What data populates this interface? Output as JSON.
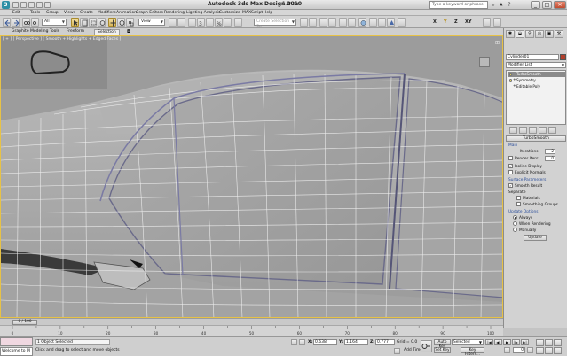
{
  "titlebar": {
    "app_title": "Autodesk 3ds Max Design 2010",
    "file_name": "1.max",
    "search_placeholder": "Type a keyword or phrase",
    "minimize": "_",
    "maximize": "□",
    "close": "✕"
  },
  "menu": [
    "Edit",
    "Tools",
    "Group",
    "Views",
    "Create",
    "Modifiers",
    "Animation",
    "Graph Editors",
    "Rendering",
    "Lighting Analysis",
    "Customize",
    "MAXScript",
    "Help"
  ],
  "toolbar": {
    "selection_filter": "All",
    "ref_coord": "View",
    "named_selection": "Create Selection Se"
  },
  "ribbon": {
    "title": "Graphite Modeling Tools",
    "tabs": [
      "Freeform",
      "Selection"
    ],
    "selected_tab": "Selection"
  },
  "viewport": {
    "label": "[ + ] [ Perspective ] [ Smooth + Highlights + Edged Faces ]"
  },
  "command_panel": {
    "object_name": "Cylinder01",
    "modifier_list": "Modifier List",
    "stack": [
      {
        "label": "TurboSmooth",
        "selected": true
      },
      {
        "label": "Symmetry",
        "selected": false
      },
      {
        "label": "Editable Poly",
        "selected": false
      }
    ],
    "rollout_title": "TurboSmooth",
    "main_group": "Main",
    "iterations_label": "Iterations:",
    "iterations_value": "2",
    "render_iters_label": "Render Iters:",
    "render_iters_value": "0",
    "isoline_label": "Isoline Display",
    "isoline_checked": true,
    "explicit_normals_label": "Explicit Normals",
    "explicit_normals_checked": false,
    "surface_group": "Surface Parameters",
    "smooth_result_label": "Smooth Result",
    "smooth_result_checked": true,
    "separate_label": "Separate",
    "materials_label": "Materials",
    "smoothing_groups_label": "Smoothing Groups",
    "update_group": "Update Options",
    "update_options": [
      "Always",
      "When Rendering",
      "Manually"
    ],
    "update_selected": "Always",
    "update_button": "Update"
  },
  "timeline": {
    "slider_label": "0 / 100",
    "current_frame": 0,
    "total_frames": 100,
    "ticks": [
      "0",
      "10",
      "20",
      "30",
      "40",
      "50",
      "60",
      "70",
      "80",
      "90",
      "100"
    ]
  },
  "status": {
    "listener_text": "Welcome to M",
    "selection_count": "1 Object Selected",
    "prompt": "Click and drag to select and move objects",
    "x_label": "X:",
    "x_value": "0.638",
    "y_label": "Y:",
    "y_value": "1.164",
    "z_label": "Z:",
    "z_value": "0.777",
    "grid": "Grid = 0.0",
    "add_time_tag": "Add Time Tag",
    "auto_key": "Auto Key",
    "set_key": "Set Key",
    "key_mode": "Selected",
    "key_filters": "Key Filters...",
    "frame_value": "0"
  }
}
